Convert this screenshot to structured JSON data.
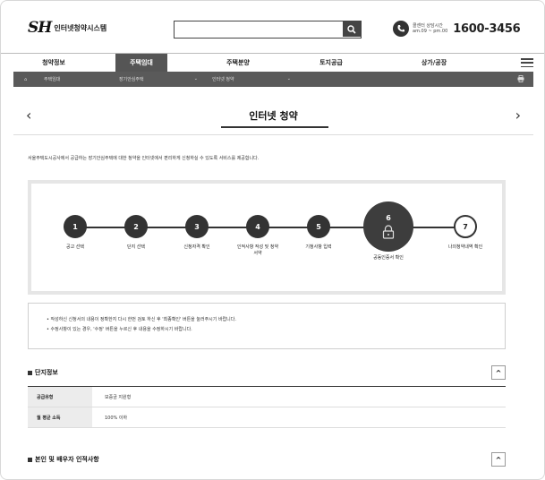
{
  "header": {
    "logo_mark": "SH",
    "logo_text": "인터넷청약시스템",
    "search_placeholder": "",
    "phone_hours_line1": "콜센터 상담시간",
    "phone_hours_line2": "am.09 ~ pm.00",
    "phone_number": "1600-3456"
  },
  "nav": {
    "items": [
      {
        "label": "청약정보",
        "active": false
      },
      {
        "label": "주택임대",
        "active": true
      },
      {
        "label": "주택분양",
        "active": false
      },
      {
        "label": "토지공급",
        "active": false
      },
      {
        "label": "상가/공장",
        "active": false
      }
    ]
  },
  "breadcrumb": {
    "home": "주택임대",
    "level2": "장기안심주택",
    "level3": "인터넷 청약"
  },
  "page": {
    "title": "인터넷 청약",
    "intro": "서울주택도시공사에서 공급하는 장기안심주택에 대한 청약을 인터넷에서 편리하게 신청하실 수 있도록 서비스를 제공합니다."
  },
  "steps": [
    {
      "num": "1",
      "label": "공고 선택",
      "state": "done"
    },
    {
      "num": "2",
      "label": "단지 선택",
      "state": "done"
    },
    {
      "num": "3",
      "label": "신청자격 확인",
      "state": "done"
    },
    {
      "num": "4",
      "label": "인적사항 작성 및 청약서약",
      "state": "done"
    },
    {
      "num": "5",
      "label": "기청사항 입력",
      "state": "done"
    },
    {
      "num": "6",
      "label": "공동인증서 확인",
      "state": "current"
    },
    {
      "num": "7",
      "label": "나의청약내역 확인",
      "state": "todo"
    }
  ],
  "notice": {
    "line1": "• 작성하신 신청서의 내용이 정확한지 다시 한번 검토 하신 후 '최종확인' 버튼을 눌러주시기 바랍니다.",
    "line2": "• 수정사항이 있는 경우, '수정' 버튼을 누르신 후 내용을 수정하시기 바랍니다."
  },
  "sections": {
    "complex_title": "단지정보",
    "person_title": "본인 및 배우자 인적사항",
    "toggle_symbol": "^"
  },
  "complex_info": [
    {
      "key": "공급유형",
      "value": "보증금 지원형"
    },
    {
      "key": "월 평균 소득",
      "value": "100% 이하"
    }
  ],
  "colors": {
    "dark": "#333333",
    "nav_active": "#555555",
    "breadcrumb_bg": "#5a5a5a"
  }
}
